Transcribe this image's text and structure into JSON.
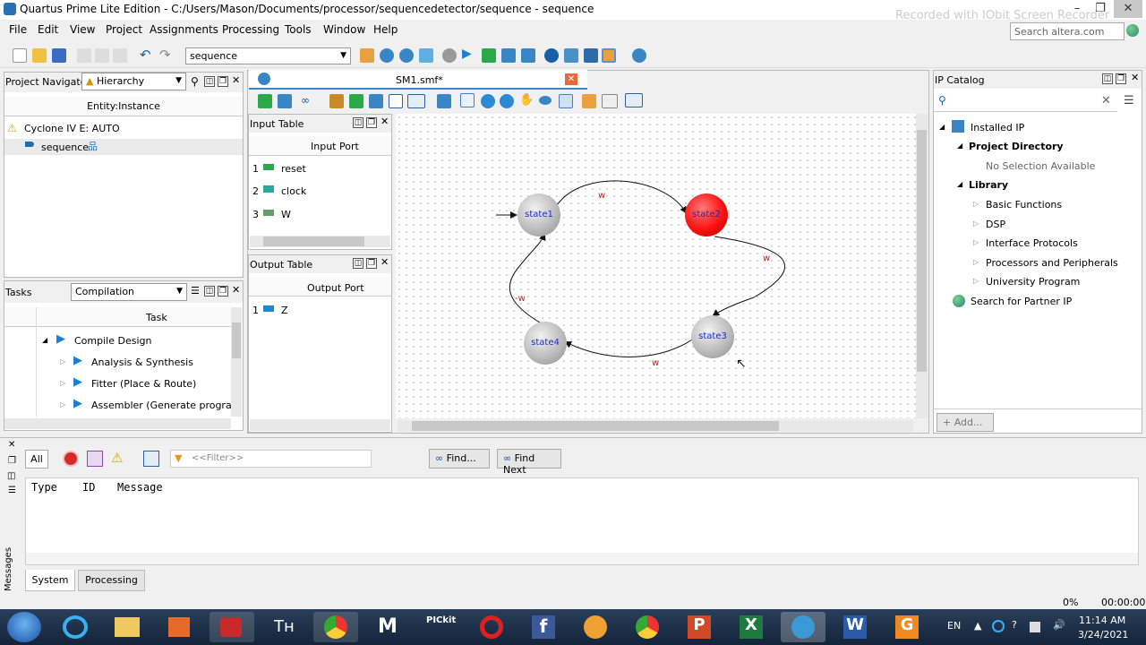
{
  "window": {
    "title": "Quartus Prime Lite Edition - C:/Users/Mason/Documents/processor/sequencedetector/sequence - sequence",
    "watermark": "Recorded with IObit Screen Recorder",
    "minimize": "–",
    "maximize": "❐",
    "close": "✕"
  },
  "menu": [
    "File",
    "Edit",
    "View",
    "Project",
    "Assignments",
    "Processing",
    "Tools",
    "Window",
    "Help"
  ],
  "search": {
    "placeholder": "Search altera.com"
  },
  "toolbar": {
    "project_combo": "sequence"
  },
  "navigator": {
    "title": "Project Navigator",
    "view": "Hierarchy",
    "column": "Entity:Instance",
    "device": "Cyclone IV E: AUTO",
    "top_entity": "sequence"
  },
  "tasks": {
    "title": "Tasks",
    "flow": "Compilation",
    "column": "Task",
    "items": [
      "Compile Design",
      "Analysis & Synthesis",
      "Fitter (Place & Route)",
      "Assembler (Generate programm"
    ]
  },
  "editor": {
    "tab": "SM1.smf*"
  },
  "input_table": {
    "title": "Input Table",
    "column": "Input Port",
    "rows": [
      {
        "n": "1",
        "name": "reset"
      },
      {
        "n": "2",
        "name": "clock"
      },
      {
        "n": "3",
        "name": "W"
      }
    ]
  },
  "output_table": {
    "title": "Output Table",
    "column": "Output Port",
    "rows": [
      {
        "n": "1",
        "name": "Z"
      }
    ]
  },
  "state_machine": {
    "states": [
      "state1",
      "state2",
      "state3",
      "state4"
    ],
    "transitions": [
      "w",
      "w",
      "w",
      "-w"
    ],
    "highlight_color": "#ff1010"
  },
  "ip_catalog": {
    "title": "IP Catalog",
    "installed": "Installed IP",
    "project_dir": "Project Directory",
    "no_selection": "No Selection Available",
    "library": "Library",
    "categories": [
      "Basic Functions",
      "DSP",
      "Interface Protocols",
      "Processors and Peripherals",
      "University Program"
    ],
    "partner": "Search for Partner IP",
    "add": "Add..."
  },
  "messages": {
    "all": "All",
    "filter_placeholder": "<<Filter>>",
    "find": "Find...",
    "find_next": "Find Next",
    "columns": [
      "Type",
      "ID",
      "Message"
    ],
    "tabs": [
      "System",
      "Processing"
    ],
    "side_label": "Messages"
  },
  "status": {
    "progress": "0%",
    "time": "00:00:00"
  },
  "taskbar": {
    "language": "EN",
    "time": "11:14 AM",
    "date": "3/24/2021",
    "picit": "PICkit"
  }
}
